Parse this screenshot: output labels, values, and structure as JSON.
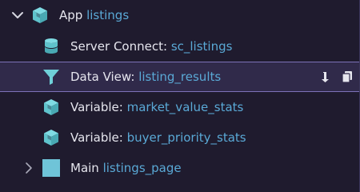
{
  "tree": {
    "root": {
      "type_label": "App",
      "name": "listings",
      "expanded": true,
      "icon": "cube-icon"
    },
    "children": [
      {
        "type_label": "Server Connect:",
        "name": "sc_listings",
        "icon": "database-icon",
        "selected": false
      },
      {
        "type_label": "Data View:",
        "name": "listing_results",
        "icon": "filter-icon",
        "selected": true,
        "actions": [
          "sort-down-icon",
          "copy-icon"
        ]
      },
      {
        "type_label": "Variable:",
        "name": "market_value_stats",
        "icon": "cube-icon",
        "selected": false
      },
      {
        "type_label": "Variable:",
        "name": "buyer_priority_stats",
        "icon": "cube-icon",
        "selected": false
      },
      {
        "type_label": "Main",
        "name": "listings_page",
        "icon": "square-icon",
        "expanded": false,
        "selected": false
      }
    ]
  },
  "colors": {
    "background": "#1f1b2e",
    "selected_bg": "#302a4a",
    "selected_border": "#7d72b8",
    "name_text": "#5aa9d6",
    "label_text": "#e6e6ee",
    "icon_teal": "#6fd0d8"
  }
}
